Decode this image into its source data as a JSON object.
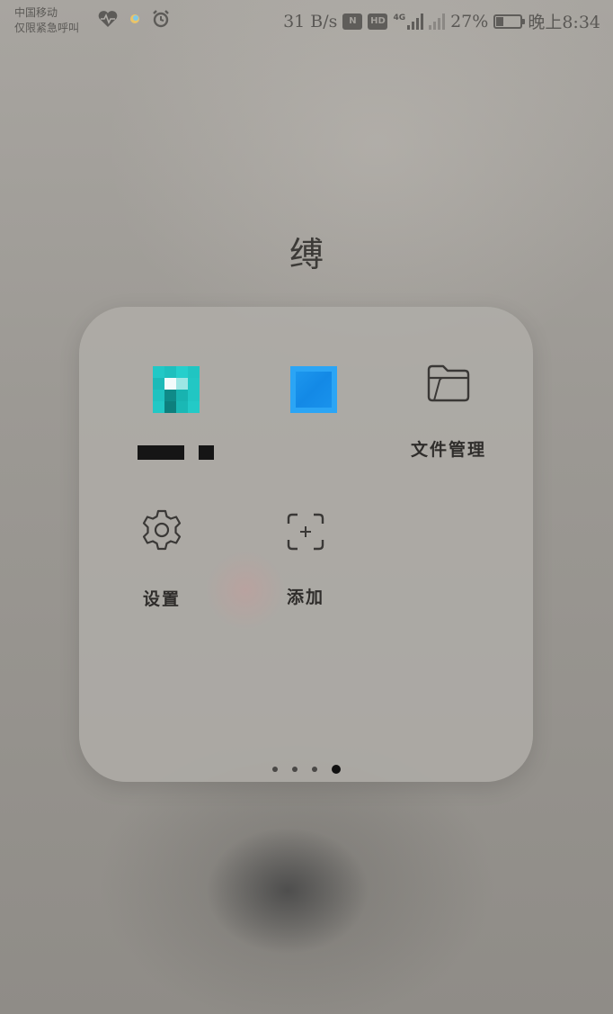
{
  "status_bar": {
    "carrier_line1": "中国移动",
    "carrier_line2": "仅限紧急呼叫",
    "net_speed": "31 B/s",
    "nfc_label": "N",
    "hd_label": "HD",
    "network_type": "4G",
    "battery_percent": "27%",
    "battery_level": 0.27,
    "time": "晚上8:34",
    "icons": [
      "heart-rate-icon",
      "weather-icon",
      "alarm-icon",
      "nfc-icon",
      "hd-icon",
      "signal-4g-icon",
      "signal-no-service-icon",
      "battery-icon"
    ]
  },
  "folder": {
    "title": "缚",
    "apps": [
      {
        "id": "app-1",
        "label": "",
        "icon": "pixelated-teal-app-icon",
        "label_redacted": true
      },
      {
        "id": "app-2",
        "label": "",
        "icon": "pixelated-blue-app-icon"
      },
      {
        "id": "app-3",
        "label": "文件管理",
        "icon": "folder-icon"
      },
      {
        "id": "app-4",
        "label": "设置",
        "icon": "gear-icon"
      },
      {
        "id": "app-5",
        "label": "添加",
        "icon": "add-icon"
      }
    ],
    "page_count": 4,
    "active_page": 4
  },
  "colors": {
    "panel_bg": "#b0ada8",
    "text_dark": "#2f2d2b",
    "teal": "#1ec9c4",
    "blue": "#1f9bf0"
  }
}
